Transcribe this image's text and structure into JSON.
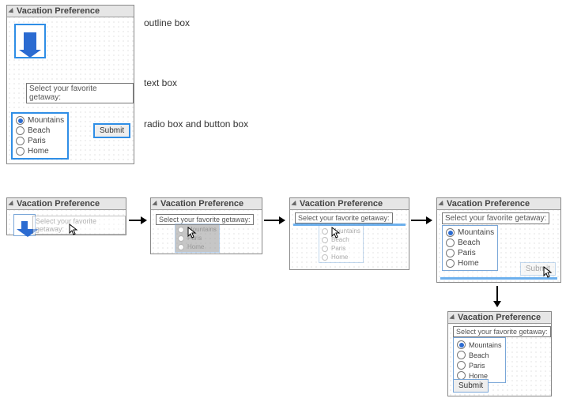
{
  "title": "Vacation Preference",
  "prompt": "Select your favorite getaway:",
  "options": [
    "Mountains",
    "Beach",
    "Paris",
    "Home"
  ],
  "selected": "Mountains",
  "submit": "Submit",
  "labels": {
    "outline": "outline box",
    "text": "text box",
    "radio": "radio box and button box"
  }
}
